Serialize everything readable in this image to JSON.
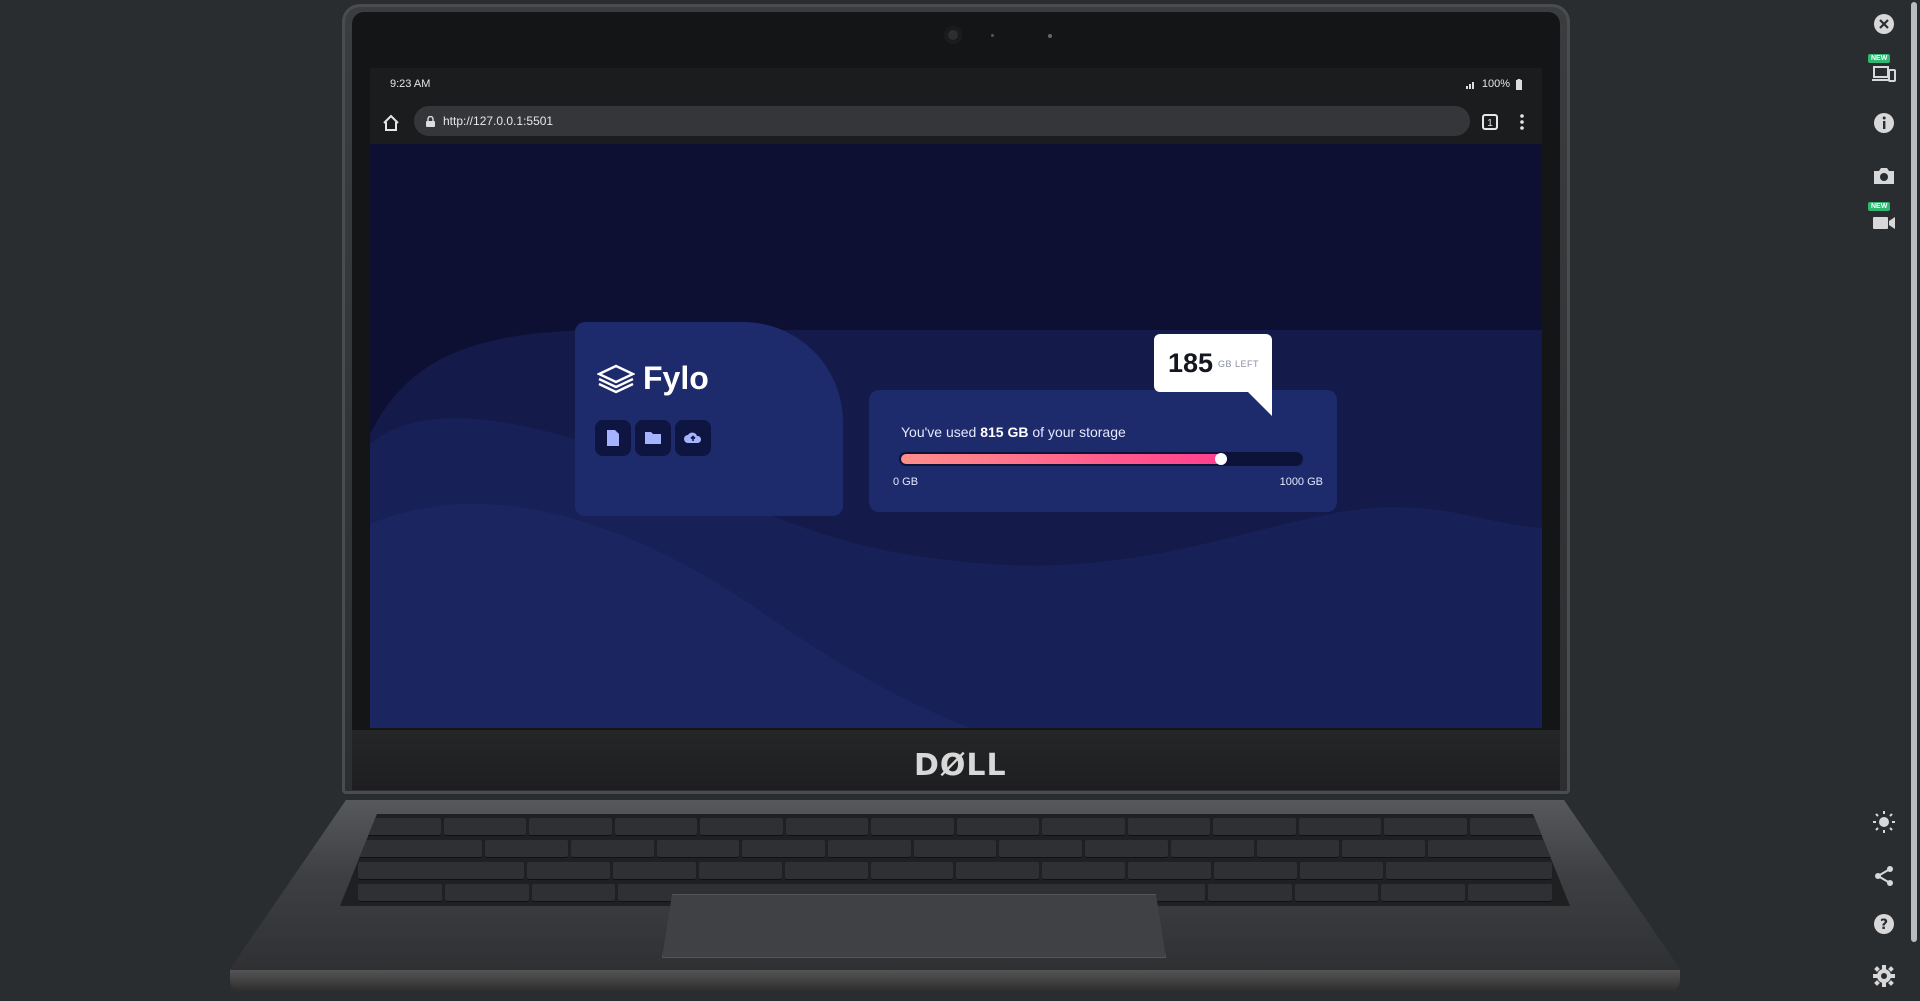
{
  "device": {
    "brand": "DØLL"
  },
  "statusbar": {
    "time": "9:23 AM",
    "battery": "100%"
  },
  "browser": {
    "url": "http://127.0.0.1:5501",
    "tab_count": "1"
  },
  "app": {
    "name": "Fylo",
    "storage": {
      "used_prefix": "You've used ",
      "used_value": "815 GB",
      "used_suffix": " of your storage",
      "min_label": "0 GB",
      "max_label": "1000 GB",
      "used_fraction": 0.815,
      "left_value": "185",
      "left_unit": "GB LEFT"
    },
    "icons": [
      "document-icon",
      "folder-icon",
      "upload-cloud-icon"
    ]
  },
  "tools": {
    "new_badge": "NEW"
  },
  "colors": {
    "page_bg": "#0d1033",
    "card_bg": "#1d2a6b",
    "gradient_start": "#ff8f8a",
    "gradient_end": "#ff3e8f"
  }
}
